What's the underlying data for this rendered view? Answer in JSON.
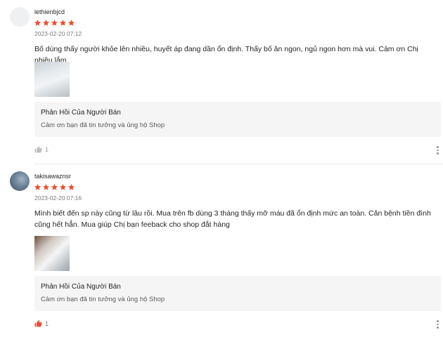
{
  "reviews": [
    {
      "username": "lethienbjcd",
      "rating": 5,
      "date": "2023-02-20 07:12",
      "comment": "Bố dùng thấy người khỏe lên nhiều, huyết áp đang dần ổn định. Thấy bố ăn ngon, ngủ ngon hơn mà vui. Cảm ơn Chị nhiều lắm",
      "image": "product-photo",
      "reply_title": "Phản Hồi Của Người Bán",
      "reply_body": "Cảm ơn bạn đã tin tưởng và ủng hộ Shop",
      "likes": "1",
      "liked": false
    },
    {
      "username": "takisawaznsr",
      "rating": 5,
      "date": "2023-02-20 07:16",
      "comment": "Mình biết đến sp này cũng từ lâu rồi. Mua trên fb dùng 3 tháng thấy mỡ máu đã ổn định mức an toàn. Căn bệnh tiền đình cũng hết hẳn. Mua giúp Chị bạn feeback cho shop đắt hàng",
      "image": "product-photo",
      "reply_title": "Phản Hồi Của Người Bán",
      "reply_body": "Cảm ơn bạn đã tin tưởng và ủng hộ Shop",
      "likes": "1",
      "liked": true
    }
  ],
  "colors": {
    "star": "#ee4d2d",
    "like_active": "#ee4d2d",
    "like_inactive": "#bfbfbf",
    "reply_bg": "#f5f5f5"
  }
}
